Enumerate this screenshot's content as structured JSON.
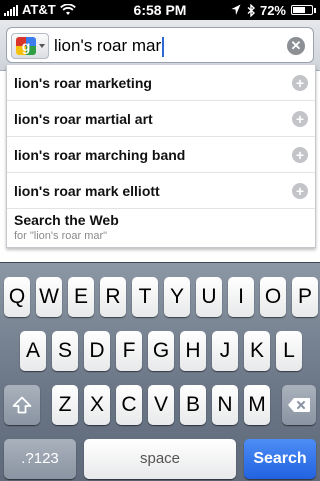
{
  "status_bar": {
    "carrier": "AT&T",
    "time": "6:58 PM",
    "battery": "72%",
    "battery_level": 0.72,
    "signal_bars": 5,
    "icons": [
      "signal-icon",
      "wifi-icon",
      "location-icon",
      "bluetooth-icon",
      "battery-icon"
    ]
  },
  "search": {
    "query": "lion's roar mar",
    "engine_icon": "google-logo-icon",
    "clear_icon": "clear-icon"
  },
  "suggestions": [
    {
      "text": "lion's roar marketing",
      "icon": "plus-icon"
    },
    {
      "text": "lion's roar martial art",
      "icon": "plus-icon"
    },
    {
      "text": "lion's roar marching band",
      "icon": "plus-icon"
    },
    {
      "text": "lion's roar mark elliott",
      "icon": "plus-icon"
    }
  ],
  "web_search": {
    "title": "Search the Web",
    "subtitle": "for \"lion's roar mar\""
  },
  "keyboard": {
    "row1": [
      "Q",
      "W",
      "E",
      "R",
      "T",
      "Y",
      "U",
      "I",
      "O",
      "P"
    ],
    "row2": [
      "A",
      "S",
      "D",
      "F",
      "G",
      "H",
      "J",
      "K",
      "L"
    ],
    "row3": [
      "Z",
      "X",
      "C",
      "V",
      "B",
      "N",
      "M"
    ],
    "shift_icon": "shift-icon",
    "delete_icon": "delete-icon",
    "num_key": ".?123",
    "space_key": "space",
    "action_key": "Search"
  },
  "colors": {
    "accent": "#2262e0",
    "status_bar": "#000000",
    "keyboard_bg": "#6a7585"
  }
}
